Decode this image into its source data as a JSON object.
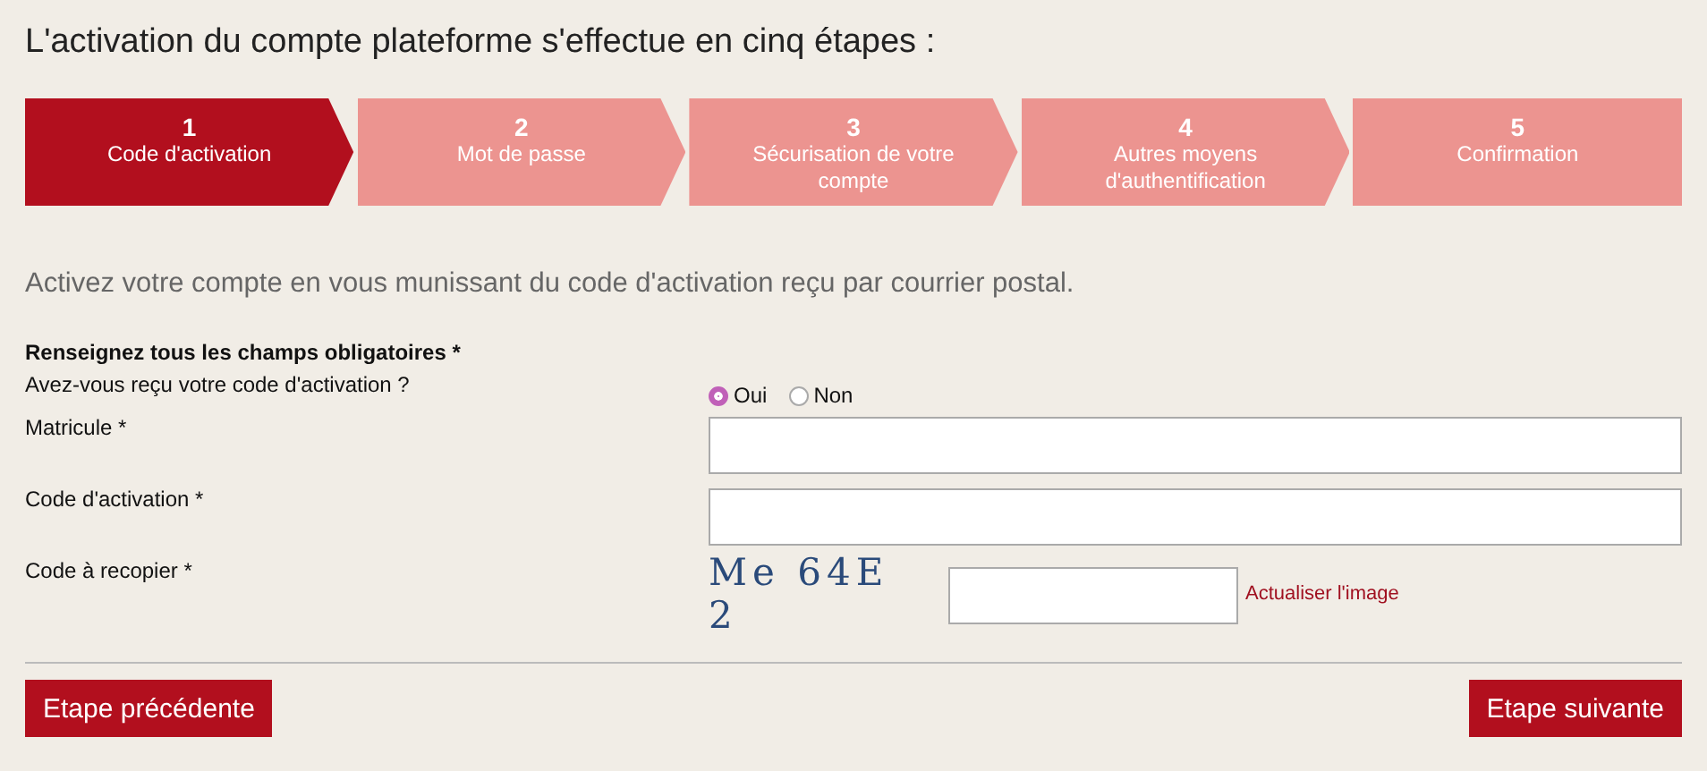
{
  "title": "L'activation du compte plateforme s'effectue en cinq étapes :",
  "steps": [
    {
      "number": "1",
      "label": "Code d'activation",
      "selected": true
    },
    {
      "number": "2",
      "label": "Mot de passe",
      "selected": false
    },
    {
      "number": "3",
      "label": "Sécurisation de votre compte",
      "selected": false
    },
    {
      "number": "4",
      "label": "Autres moyens d'authentification",
      "selected": false
    },
    {
      "number": "5",
      "label": "Confirmation",
      "selected": false
    }
  ],
  "intro": "Activez votre compte en vous munissant du code d'activation reçu par courrier postal.",
  "form": {
    "required_note": "Renseignez tous les champs obligatoires *",
    "question": {
      "label": "Avez-vous reçu votre code d'activation ?",
      "options": [
        {
          "label": "Oui",
          "selected": true
        },
        {
          "label": "Non",
          "selected": false
        }
      ]
    },
    "fields": [
      {
        "kind": "text",
        "label": "Matricule *"
      },
      {
        "kind": "text",
        "label": "Code d'activation *"
      },
      {
        "kind": "captcha",
        "label": "Code à recopier *",
        "captcha": "Me 64E 2",
        "refresh_link": "Actualiser l'image"
      }
    ]
  },
  "buttons": {
    "previous": "Etape précédente",
    "next": "Etape suivante"
  }
}
